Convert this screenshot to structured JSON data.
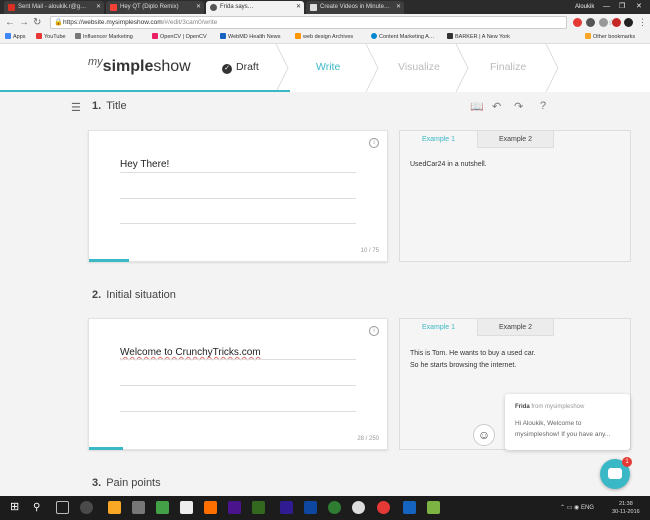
{
  "browser": {
    "tabs": [
      {
        "title": "Sent Mail - aloukik.r@g…"
      },
      {
        "title": "Hey QT (Diplo Remix)"
      },
      {
        "title": "Frida says…"
      },
      {
        "title": "Create Videos in Minute…"
      }
    ],
    "profile": "Aloukik",
    "url_host": "https://website.mysimpleshow.com",
    "url_path": "/#/edit/3cam0/write",
    "bookmarks": [
      "Apps",
      "YouTube",
      "Influencer Marketing",
      "OpenCV | OpenCV",
      "WebMD Health News",
      "web design Archives",
      "Content Marketing A…",
      "BARKER | A New York",
      "Other bookmarks"
    ]
  },
  "app": {
    "logo_my": "my",
    "logo_simple": "simple",
    "logo_show": "show",
    "steps": {
      "draft": "Draft",
      "write": "Write",
      "visualize": "Visualize",
      "finalize": "Finalize"
    },
    "check": "✓"
  },
  "sections": [
    {
      "num": "1.",
      "title": "Title",
      "text": "Hey There!",
      "counter": "10 / 75",
      "ex_tab1": "Example 1",
      "ex_tab2": "Example 2",
      "example": "UsedCar24 in a nutshell."
    },
    {
      "num": "2.",
      "title": "Initial situation",
      "text": "Welcome to CrunchyTricks.com",
      "counter": "28 / 250",
      "ex_tab1": "Example 1",
      "ex_tab2": "Example 2",
      "example": "This is Tom. He wants to buy a used car. So he starts browsing the internet."
    },
    {
      "num": "3.",
      "title": "Pain points"
    }
  ],
  "chat": {
    "sender": "Frida",
    "from_label": "from mysimpleshow",
    "message": "Hi Aloukik, Welcome to mysimpleshow! If you have any...",
    "badge": "1"
  },
  "taskbar": {
    "lang": "ENG",
    "time": "21:38",
    "date": "30-11-2016"
  },
  "colors": {
    "accent": "#3bb8c5",
    "badge": "#e53935"
  }
}
